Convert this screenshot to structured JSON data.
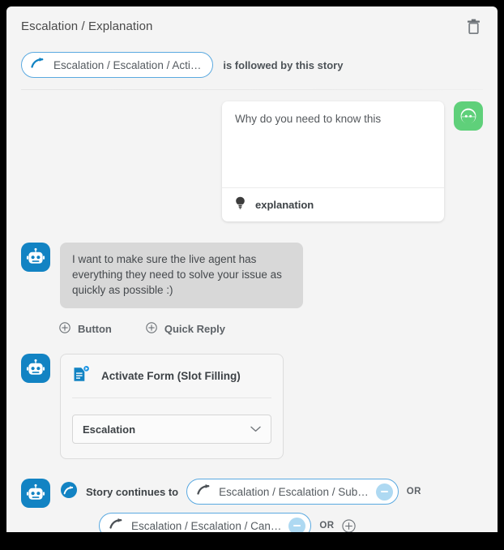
{
  "header": {
    "title": "Escalation / Explanation",
    "delete_icon": "trash-icon"
  },
  "followed_by": {
    "chip_icon": "redirect-arrow-icon",
    "chip_label": "Escalation / Escalation / Acti…",
    "text": "is followed by this story"
  },
  "conversation": {
    "user_turn": {
      "avatar_icon": "user-face-avatar-icon",
      "message": "Why do you need to know this",
      "intent_icon": "lightbulb-icon",
      "intent_label": "explanation"
    },
    "bot_turn": {
      "avatar_icon": "robot-avatar-icon",
      "message": "I want to make sure the live agent has everything they need to solve your issue as quickly as possible :)",
      "actions": [
        {
          "icon": "plus-circle-icon",
          "label": "Button"
        },
        {
          "icon": "plus-circle-icon",
          "label": "Quick Reply"
        }
      ]
    },
    "form_turn": {
      "avatar_icon": "robot-avatar-icon",
      "card_icon": "form-document-icon",
      "title": "Activate Form (Slot Filling)",
      "select_value": "Escalation",
      "select_caret_icon": "chevron-down-icon"
    },
    "continues_turn": {
      "avatar_icon": "robot-avatar-icon",
      "link_icon": "arrow-circle-icon",
      "label": "Story continues to",
      "branches": [
        {
          "chip_icon": "redirect-arrow-icon",
          "chip_label": "Escalation / Escalation / Sub…",
          "remove_icon": "minus-circle-icon",
          "or_text": "OR"
        },
        {
          "chip_icon": "redirect-arrow-icon",
          "chip_label": "Escalation / Escalation / Can…",
          "remove_icon": "minus-circle-icon",
          "or_text": "OR",
          "add_icon": "plus-circle-icon"
        }
      ]
    }
  },
  "colors": {
    "accent_blue": "#1283c3",
    "chip_border": "#5aa9e0",
    "avatar_green": "#5fd07a",
    "bubble_grey": "#d8d8d8",
    "page_bg": "#f4f4f4"
  }
}
